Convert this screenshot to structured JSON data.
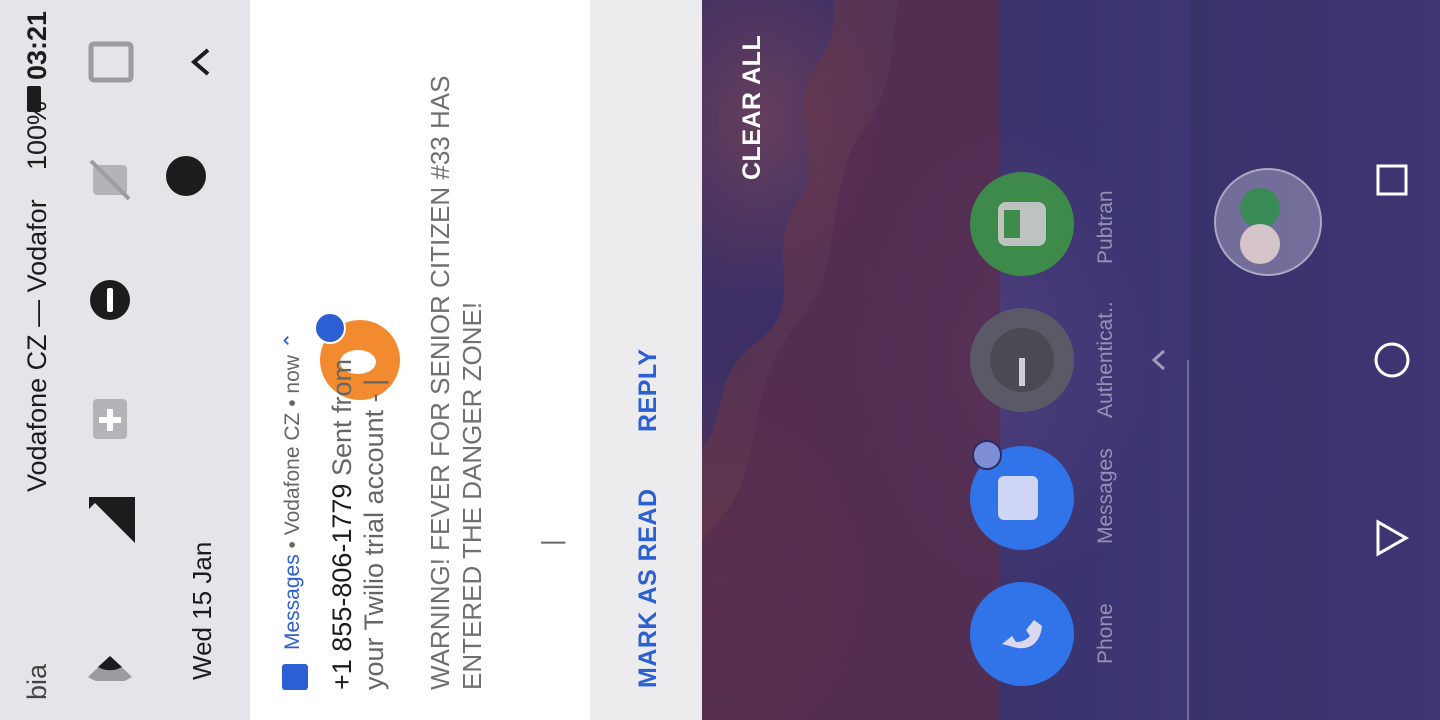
{
  "status_bar": {
    "carrier": "Vodafone CZ — Vodafor",
    "battery": "100%",
    "time": "03:21",
    "left_partial": "bia"
  },
  "quick_settings": {
    "date": "Wed 15 Jan",
    "tiles": [
      "wifi-icon",
      "signal-icon",
      "battery-saver-icon",
      "do-not-disturb-icon",
      "rotation-off-icon",
      "cast-icon"
    ]
  },
  "notification": {
    "app": "Messages",
    "account": "Vodafone CZ",
    "when": "now",
    "sep1": "•",
    "sep2": "•",
    "sender": "+1 855-806-1779",
    "preview": "Sent from your Twilio trial account - |",
    "body_lines": [
      "WARNING! FEVER FOR SENIOR CITIZEN #33 HAS",
      "ENTERED THE DANGER ZONE!"
    ],
    "cursor": "|",
    "actions": {
      "mark_read": "MARK AS READ",
      "reply": "REPLY"
    },
    "colors": {
      "accent": "#2c5fd1"
    }
  },
  "shade": {
    "clear_all": "CLEAR ALL"
  },
  "dock": {
    "apps": [
      {
        "label": "Phone",
        "icon": "phone-icon",
        "color": "#3173e8"
      },
      {
        "label": "Messages",
        "icon": "messages-icon",
        "color": "#3173e8"
      },
      {
        "label": "Authenticat..",
        "icon": "authenticator-icon",
        "color": "#5a5a66"
      },
      {
        "label": "Pubtran",
        "icon": "bus-icon",
        "color": "#3e8a4a"
      }
    ],
    "folder_icons": [
      "whatsapp-icon",
      "sigma-icon"
    ]
  },
  "nav_bar": {
    "buttons": [
      "back-icon",
      "home-icon",
      "recents-icon"
    ]
  }
}
